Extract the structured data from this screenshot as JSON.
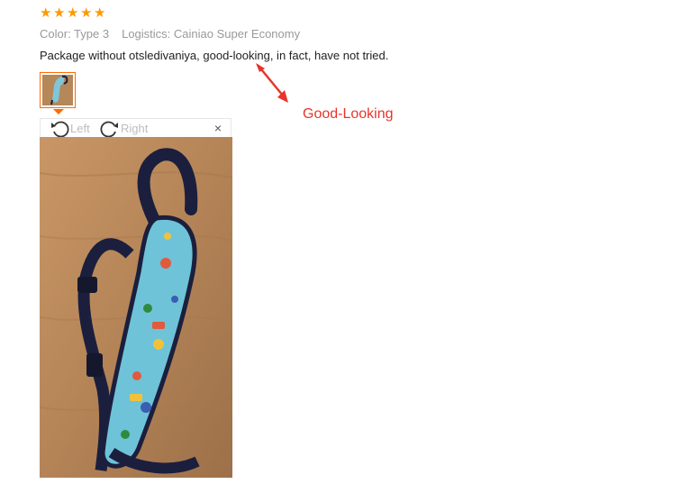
{
  "rating": {
    "stars": 5,
    "star_glyph": "★",
    "color": "#ff9900"
  },
  "meta": {
    "color_label": "Color: Type 3",
    "logistics_label": "Logistics: Cainiao Super Economy"
  },
  "review": {
    "text": "Package without otsledivaniya, good-looking, in fact, have not tried."
  },
  "viewer": {
    "rotate_left_label": "Left",
    "rotate_right_label": "Right",
    "close_glyph": "×",
    "accent": "#ff6a00"
  },
  "annotation": {
    "text": "Good-Looking",
    "color": "#e8342a"
  }
}
